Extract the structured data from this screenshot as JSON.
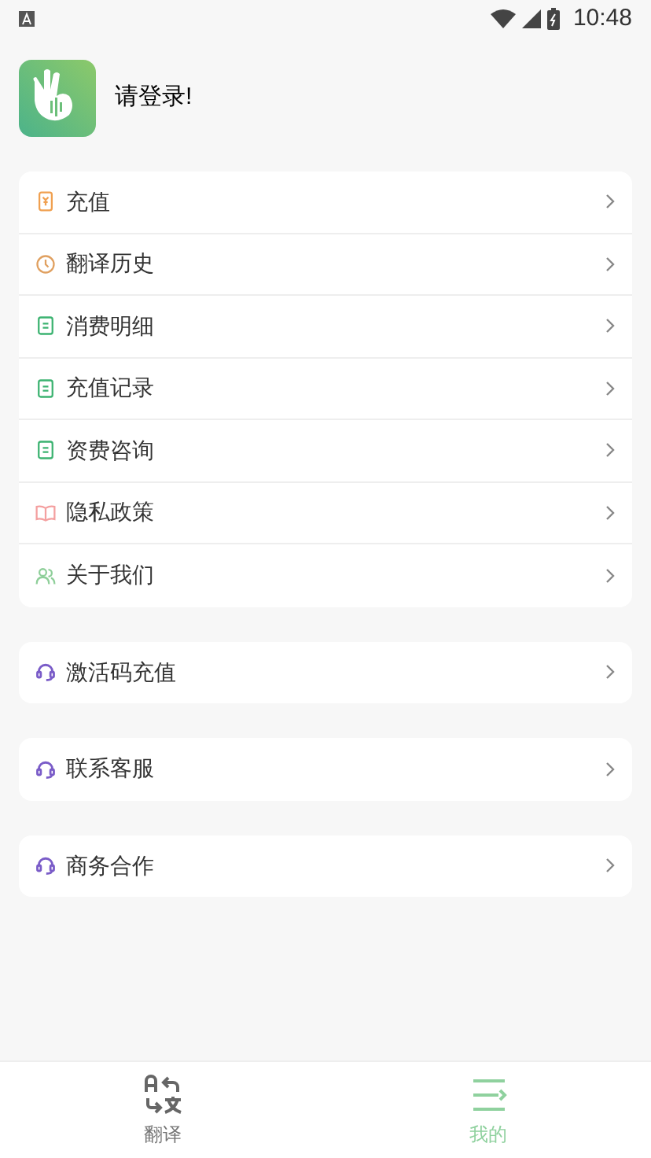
{
  "status_bar": {
    "time": "10:48"
  },
  "profile": {
    "name": "请登录!"
  },
  "menu_groups": [
    {
      "items": [
        {
          "kind": "phone",
          "label": "充值"
        },
        {
          "kind": "clock",
          "label": "翻译历史"
        },
        {
          "kind": "note",
          "label": "消费明细"
        },
        {
          "kind": "note",
          "label": "充值记录"
        },
        {
          "kind": "note",
          "label": "资费咨询"
        },
        {
          "kind": "book",
          "label": "隐私政策"
        },
        {
          "kind": "people",
          "label": "关于我们"
        }
      ]
    },
    {
      "items": [
        {
          "kind": "headset",
          "label": "激活码充值"
        }
      ]
    },
    {
      "items": [
        {
          "kind": "headset",
          "label": "联系客服"
        }
      ]
    },
    {
      "items": [
        {
          "kind": "headset",
          "label": "商务合作"
        }
      ]
    }
  ],
  "tab_bar": [
    {
      "kind": "translate",
      "label": "翻译",
      "selected": false
    },
    {
      "kind": "mine",
      "label": "我的",
      "selected": true
    }
  ]
}
